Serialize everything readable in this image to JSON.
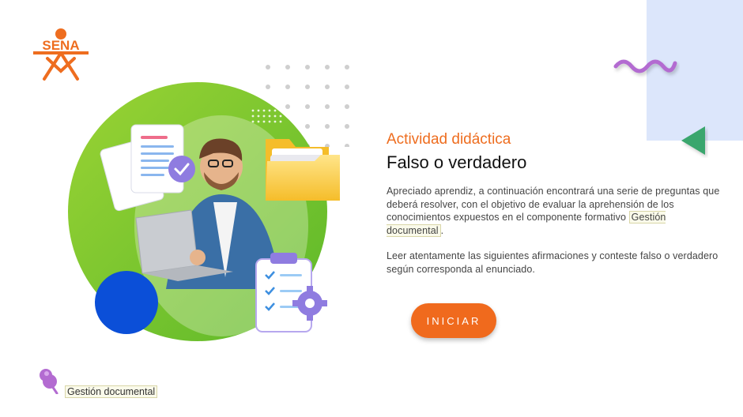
{
  "logo": {
    "text": "SENA",
    "color": "#ee6d1f"
  },
  "activity": {
    "subtitle": "Actividad didáctica",
    "title": "Falso o verdadero",
    "paragraph1_before": "Apreciado aprendiz, a continuación encontrará una serie de preguntas que deberá resolver, con el objetivo de evaluar la aprehensión de los conocimientos expuestos en el componente formativo ",
    "paragraph1_link": "Gestión documental",
    "paragraph1_after": ".",
    "paragraph2": "Leer atentamente las siguientes afirmaciones y conteste falso o verdadero según corresponda al enunciado."
  },
  "start_button": {
    "label": "INICIAR"
  },
  "footer": {
    "label": "Gestión documental",
    "icon": "pin-icon"
  },
  "colors": {
    "accent": "#ee6d1f",
    "green": "#7cc52c",
    "blue": "#0b4fd8",
    "purple": "#b36bd1",
    "triangle": "#3aa66d",
    "deco_bg": "#dce6fb"
  }
}
